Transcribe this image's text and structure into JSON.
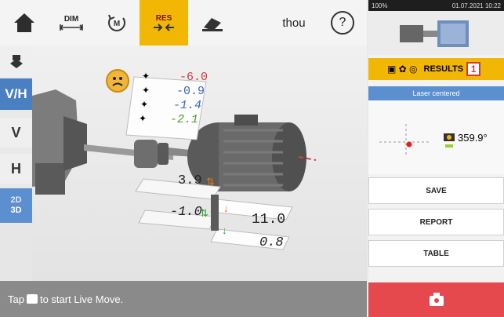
{
  "toolbar": {
    "dim_label": "DIM",
    "res_label": "RES",
    "unit_label": "thou",
    "help_label": "?"
  },
  "rail": {
    "vh_label": "V/H",
    "v_label": "V",
    "h_label": "H",
    "dim2_label": "2D",
    "dim3_label": "3D"
  },
  "scene": {
    "tolerance": {
      "row1": "-6.0",
      "row2": "-0.9",
      "row3": "-1.4",
      "row4": "-2.1"
    },
    "vertical_value": "3.9",
    "horizontal_value": "-1.0",
    "vertical_foot_value": "11.0",
    "horizontal_foot_value": "0.8"
  },
  "hint": {
    "prefix": "Tap",
    "suffix": "to start Live Move."
  },
  "status_bar": {
    "battery": "100%",
    "datetime": "01.07.2021 10:22"
  },
  "right_panel": {
    "results_label": "RESULTS",
    "results_count": "1",
    "laser_status": "Laser centered",
    "angle_value": "359.9°",
    "save_label": "SAVE",
    "report_label": "REPORT",
    "table_label": "TABLE"
  },
  "colors": {
    "accent_yellow": "#f2b705",
    "rail_blue": "#4a7fc1",
    "laser_blue": "#5c8fd0",
    "live_move_red": "#e5484d"
  }
}
